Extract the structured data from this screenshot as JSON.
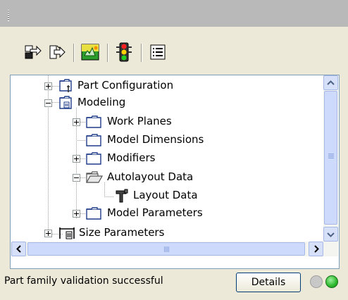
{
  "toolbar": {
    "buttons": [
      {
        "name": "import",
        "icon": "arrows-import-icon"
      },
      {
        "name": "export",
        "icon": "arrows-export-icon"
      },
      {
        "name": "validate",
        "icon": "landscape-icon"
      },
      {
        "name": "traffic",
        "icon": "traffic-light-icon"
      },
      {
        "name": "list",
        "icon": "list-icon"
      }
    ]
  },
  "tree": {
    "nodes": [
      {
        "label": "Part Configuration",
        "expander": "plus"
      },
      {
        "label": "Modeling",
        "expander": "minus"
      },
      {
        "label": "Work Planes",
        "expander": "plus"
      },
      {
        "label": "Model Dimensions",
        "expander": ""
      },
      {
        "label": "Modifiers",
        "expander": "plus"
      },
      {
        "label": "Autolayout Data",
        "expander": "minus"
      },
      {
        "label": "Layout Data",
        "expander": ""
      },
      {
        "label": "Model Parameters",
        "expander": "plus"
      },
      {
        "label": "Size Parameters",
        "expander": "plus"
      }
    ]
  },
  "status": {
    "message": "Part family validation successful",
    "details_label": "Details",
    "indicators": {
      "grey": "#c8c8c8",
      "green": "#3cc43c"
    }
  }
}
